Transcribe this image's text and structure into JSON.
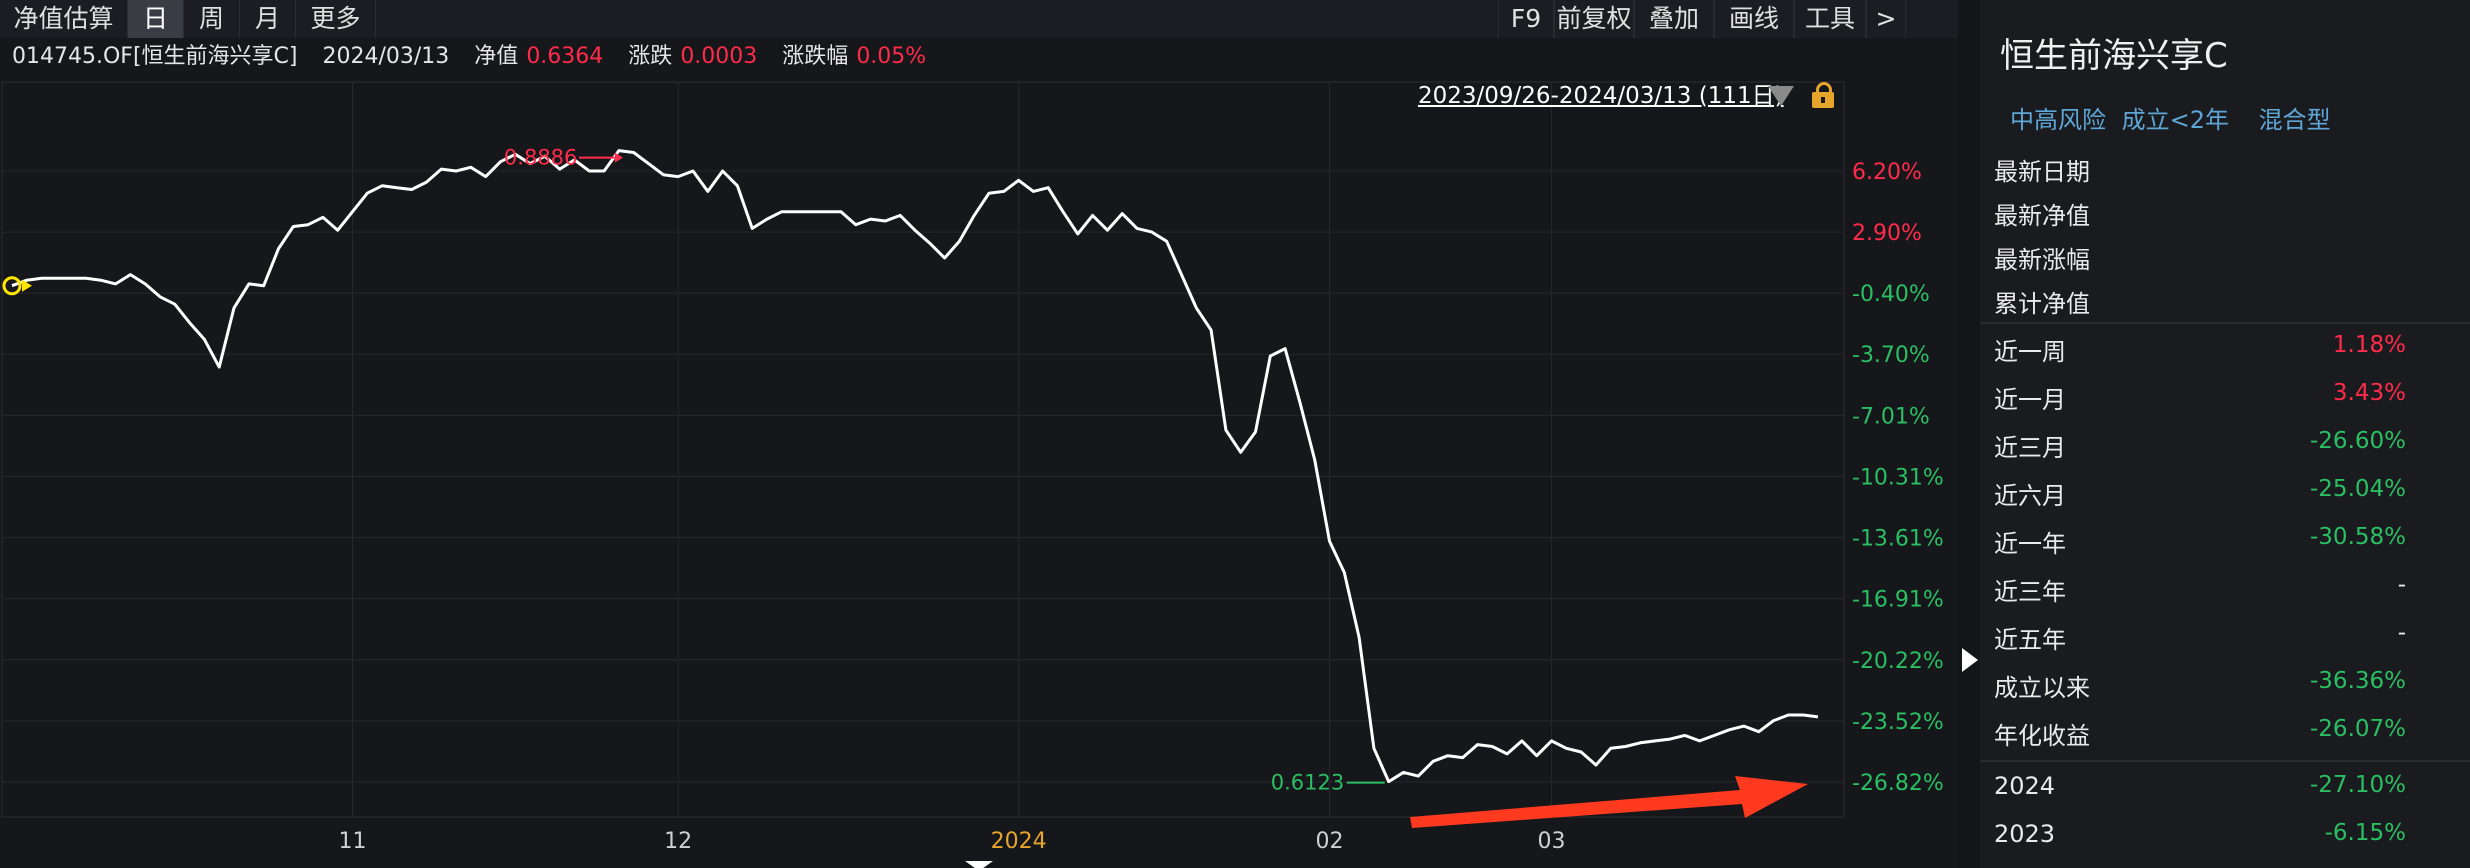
{
  "toolbar": {
    "left": [
      "净值估算",
      "日",
      "周",
      "月",
      "更多"
    ],
    "active_index": 1,
    "right": [
      "F9",
      "前复权",
      "叠加",
      "画线",
      "工具",
      ">"
    ]
  },
  "info": {
    "code": "014745.OF[恒生前海兴享C]",
    "date": "2024/03/13",
    "nav_label": "净值",
    "nav_value": "0.6364",
    "change_label": "涨跌",
    "change_value": "0.0003",
    "pct_label": "涨跌幅",
    "pct_value": "0.05%"
  },
  "range": {
    "text": "2023/09/26-2024/03/13 (111日)"
  },
  "panel": {
    "title": "恒生前海兴享C",
    "tags": [
      "中高风险",
      "成立<2年",
      "混合型"
    ],
    "fields": [
      "最新日期",
      "最新净值",
      "最新涨幅",
      "累计净值"
    ],
    "returns": [
      {
        "label": "近一周",
        "value": "1.18%",
        "color": "red"
      },
      {
        "label": "近一月",
        "value": "3.43%",
        "color": "red"
      },
      {
        "label": "近三月",
        "value": "-26.60%",
        "color": "green"
      },
      {
        "label": "近六月",
        "value": "-25.04%",
        "color": "green"
      },
      {
        "label": "近一年",
        "value": "-30.58%",
        "color": "green"
      },
      {
        "label": "近三年",
        "value": "-",
        "color": "white"
      },
      {
        "label": "近五年",
        "value": "-",
        "color": "white"
      },
      {
        "label": "成立以来",
        "value": "-36.36%",
        "color": "green"
      },
      {
        "label": "年化收益",
        "value": "-26.07%",
        "color": "green"
      }
    ],
    "years": [
      {
        "label": "2024",
        "value": "-27.10%",
        "color": "green"
      },
      {
        "label": "2023",
        "value": "-6.15%",
        "color": "green"
      }
    ]
  },
  "chart_data": {
    "type": "line",
    "y_ticks": [
      "6.20%",
      "2.90%",
      "-0.40%",
      "-3.70%",
      "-7.01%",
      "-10.31%",
      "-13.61%",
      "-16.91%",
      "-20.22%",
      "-23.52%",
      "-26.82%"
    ],
    "y_tick_values": [
      6.2,
      2.9,
      -0.4,
      -3.7,
      -7.01,
      -10.31,
      -13.61,
      -16.91,
      -20.22,
      -23.52,
      -26.82
    ],
    "x_ticks": [
      "11",
      "12",
      "2024",
      "02",
      "03"
    ],
    "x_tick_indices": [
      23,
      45,
      68,
      89,
      104
    ],
    "series": [
      {
        "name": "",
        "values": [
          0.0,
          0.3,
          0.4,
          0.4,
          0.4,
          0.4,
          0.3,
          0.1,
          0.6,
          0.1,
          -0.6,
          -1.0,
          -2.0,
          -2.9,
          -4.4,
          -1.2,
          0.1,
          0.0,
          2.0,
          3.2,
          3.3,
          3.7,
          3.0,
          4.0,
          5.0,
          5.4,
          5.3,
          5.2,
          5.6,
          6.3,
          6.2,
          6.4,
          5.9,
          6.7,
          7.1,
          6.6,
          7.0,
          6.3,
          6.8,
          6.2,
          6.2,
          7.3,
          7.2,
          6.6,
          6.0,
          5.9,
          6.2,
          5.1,
          6.2,
          5.4,
          3.1,
          3.6,
          4.0,
          4.0,
          4.0,
          4.0,
          4.0,
          3.3,
          3.6,
          3.5,
          3.8,
          3.0,
          2.3,
          1.5,
          2.4,
          3.8,
          5.0,
          5.1,
          5.7,
          5.1,
          5.3,
          4.0,
          2.8,
          3.8,
          3.0,
          3.9,
          3.1,
          2.9,
          2.4,
          0.6,
          -1.2,
          -2.4,
          -7.8,
          -9.0,
          -7.9,
          -3.8,
          -3.4,
          -6.3,
          -9.4,
          -13.8,
          -15.5,
          -19.0,
          -25.0,
          -26.8,
          -26.3,
          -26.5,
          -25.7,
          -25.4,
          -25.5,
          -24.8,
          -24.9,
          -25.3,
          -24.6,
          -25.4,
          -24.6,
          -25.0,
          -25.2,
          -25.9,
          -25.0,
          -24.9,
          -24.7,
          -24.6,
          -24.5,
          -24.3,
          -24.6,
          -24.3,
          -24.0,
          -23.8,
          -24.1,
          -23.5,
          -23.2,
          -23.2,
          -23.3
        ]
      }
    ],
    "max_label": "0.8886",
    "min_label": "0.6123",
    "max_index": 41,
    "min_index": 93
  }
}
